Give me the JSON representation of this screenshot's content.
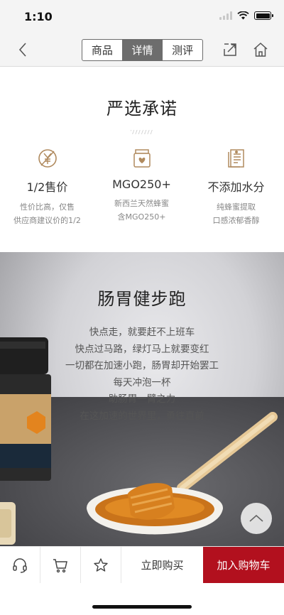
{
  "status_bar": {
    "time": "1:10"
  },
  "nav": {
    "tabs": [
      {
        "label": "商品",
        "active": false
      },
      {
        "label": "详情",
        "active": true
      },
      {
        "label": "测评",
        "active": false
      }
    ]
  },
  "promise": {
    "title": "严选承诺",
    "features": [
      {
        "icon": "price-tag-icon",
        "title": "1/2售价",
        "desc_line1": "性价比高，仅售",
        "desc_line2": "供应商建议价的1/2"
      },
      {
        "icon": "honey-jar-icon",
        "title": "MGO250+",
        "desc_line1": "新西兰天然蜂蜜",
        "desc_line2": "含MGO250+"
      },
      {
        "icon": "document-icon",
        "title": "不添加水分",
        "desc_line1": "纯蜂蜜提取",
        "desc_line2": "口感浓郁香醇"
      }
    ]
  },
  "hero": {
    "title": "肠胃健步跑",
    "lines": [
      "快点走，就要赶不上班车",
      "快点过马路，绿灯马上就要变红",
      "一切都在加速小跑，肠胃却开始罢工",
      "每天冲泡一杯",
      "助肠胃一臂之力",
      "在这加速的世界里，勇往直前"
    ]
  },
  "action_bar": {
    "icons": [
      "customer-service-icon",
      "cart-icon",
      "star-icon"
    ],
    "buy_now": "立即购买",
    "add_to_cart": "加入购物车",
    "add_to_cart_color": "#b2101e"
  }
}
